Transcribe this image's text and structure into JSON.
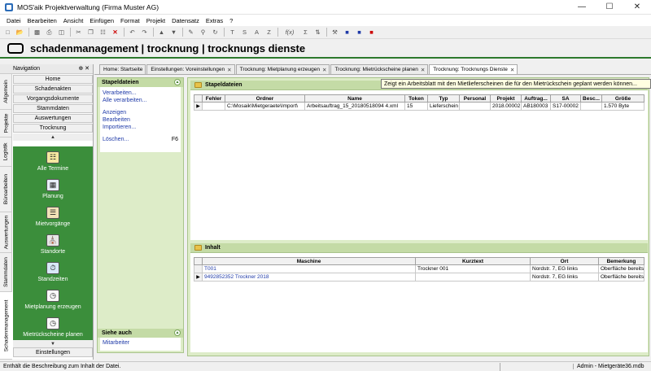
{
  "window": {
    "title": "MOS'aik Projektverwaltung (Firma Muster AG)"
  },
  "menu": [
    "Datei",
    "Bearbeiten",
    "Ansicht",
    "Einfügen",
    "Format",
    "Projekt",
    "Datensatz",
    "Extras",
    "?"
  ],
  "toolbar": {
    "text_buttons": [
      "T",
      "S",
      "A",
      "Z"
    ],
    "function_label": "f(x)"
  },
  "header": {
    "title": "schadenmanagement | trocknung | trocknungs dienste"
  },
  "navigation": {
    "title": "Navigation",
    "vertical_tabs": [
      "Allgemein",
      "Projekte",
      "Logistik",
      "Büroarbeiten",
      "Auswertungen",
      "Stammdaten",
      "Schadenmanagement"
    ],
    "buttons": [
      "Home",
      "Schadenakten",
      "Vorgangsdokumente",
      "Stammdaten",
      "Auswertungen",
      "Trocknung"
    ],
    "items": [
      "Alle Termine",
      "Planung",
      "Mietvorgänge",
      "Standorte",
      "Standzeiten",
      "Mietplanung erzeugen",
      "Mietrückscheine planen"
    ],
    "bottom_button": "Einstellungen"
  },
  "tabs": [
    "Home: Startseite",
    "Einstellungen: Voreinstellungen",
    "Trocknung: Mietplanung erzeugen",
    "Trocknung: Mietrückscheine planen",
    "Trocknung: Trocknungs Dienste"
  ],
  "tasks": {
    "stapel_title": "Stapeldateien",
    "stapel_links": [
      "Verarbeiten...",
      "Alle verarbeiten...",
      "Anzeigen",
      "Bearbeiten",
      "Importieren...",
      "Löschen..."
    ],
    "delete_shortcut": "F6",
    "siehe_title": "Siehe auch",
    "siehe_links": [
      "Mitarbeiter"
    ]
  },
  "stapel": {
    "title": "Stapeldateien",
    "columns": [
      "Fehler",
      "Ordner",
      "Name",
      "Token",
      "Typ",
      "Personal",
      "Projekt",
      "Auftrag...",
      "SA",
      "Besc...",
      "Größe"
    ],
    "rows": [
      [
        "",
        "C:\\Mosaik\\Mietgeraete\\Import\\",
        "Arbeitsauftrag_15_20180518094 4.xml",
        "15",
        "Lieferschein",
        "",
        "2018.00002",
        "AB180003",
        "S17-00002",
        "",
        "1.570 Byte"
      ]
    ]
  },
  "tooltip": "Zeigt ein Arbeitsblatt mit den Mietlieferscheinen die für den Mietrückschein geplant werden können...",
  "inhalt": {
    "title": "Inhalt",
    "columns": [
      "Maschine",
      "Kurztext",
      "Ort",
      "Bemerkung"
    ],
    "rows": [
      [
        "T001",
        "Trockner 001",
        "Nordstr. 7, EG links",
        "Oberfläche bereits ..."
      ],
      [
        "9492852352 Trockner 2018",
        "",
        "Nordstr. 7, EG links",
        "Oberfläche bereits ..."
      ]
    ]
  },
  "status": {
    "left": "Enthält die Beschreibung zum Inhalt der Datei.",
    "right": "Admin - Mietgeräte36.mdb"
  }
}
